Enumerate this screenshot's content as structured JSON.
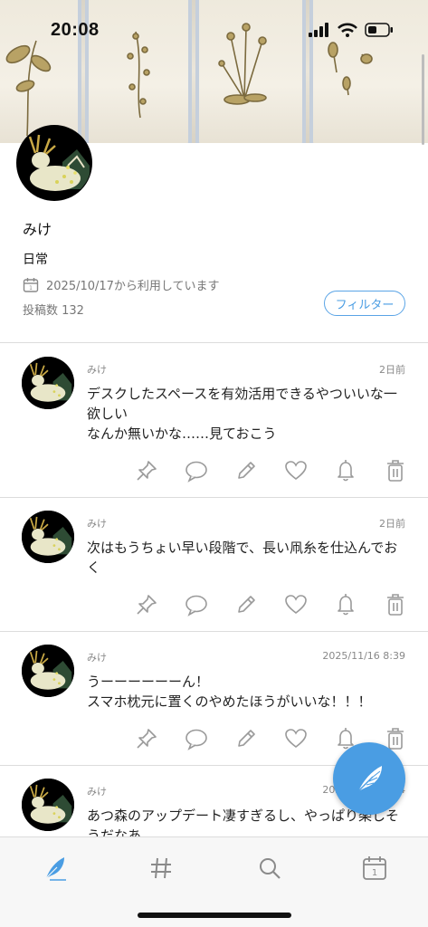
{
  "status_bar": {
    "time": "20:08"
  },
  "profile": {
    "name": "みけ",
    "bio": "日常",
    "since": "2025/10/17から利用しています",
    "post_count": "投稿数 132",
    "filter_label": "フィルター"
  },
  "posts": [
    {
      "author": "みけ",
      "time": "2日前",
      "text": "デスクしたスペースを有効活用できるやついいな一欲しい\nなんか無いかな……見ておこう"
    },
    {
      "author": "みけ",
      "time": "2日前",
      "text": "次はもうちょい早い段階で、長い凧糸を仕込んでおく"
    },
    {
      "author": "みけ",
      "time": "2025/11/16 8:39",
      "text": "うーーーーーーん！\nスマホ枕元に置くのやめたほうがいいな！！！"
    },
    {
      "author": "みけ",
      "time": "2025/11/16 8:34",
      "text": "あつ森のアップデート凄すぎるし、やっぱり楽しそうだなあ"
    }
  ],
  "colors": {
    "accent": "#4a9de3",
    "icon_gray": "#9a9a9a"
  },
  "tabs": [
    "feather-icon",
    "hashtag-icon",
    "search-icon",
    "calendar-icon"
  ]
}
